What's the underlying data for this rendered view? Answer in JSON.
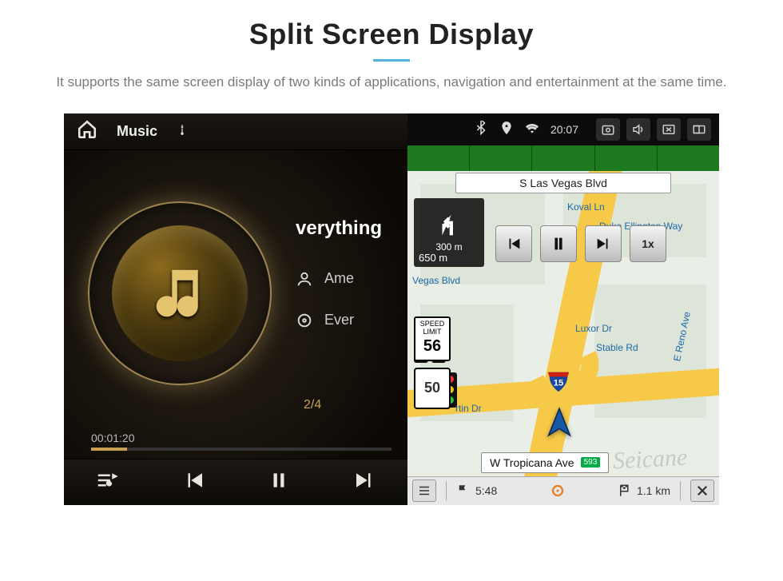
{
  "page": {
    "title": "Split Screen Display",
    "subtitle": "It supports the same screen display of two kinds of applications, navigation and entertainment at the same time."
  },
  "status_bar": {
    "time": "20:07",
    "icons": [
      "bluetooth",
      "location",
      "wifi"
    ]
  },
  "music": {
    "app_title": "Music",
    "now_playing_title": "verything",
    "artist": "Ame",
    "genre": "Ever",
    "track_position": "2/4",
    "elapsed": "00:01:20"
  },
  "nav": {
    "top_road": "S Las Vegas Blvd",
    "turn_distance_top": "300 m",
    "turn_distance_main": "650 m",
    "speed_limit_label": "SPEED LIMIT",
    "speed_limit_value": "56",
    "route_number": "50",
    "interstate": "15",
    "current_street": "W Tropicana Ave",
    "current_exit": "593",
    "overlay_speed": "1x",
    "eta": "5:48",
    "remaining_distance": "1.1 km",
    "street_labels": {
      "koval": "Koval Ln",
      "duke": "Duke Ellington Way",
      "vegas_blvd": "Vegas Blvd",
      "luxor": "Luxor Dr",
      "stable": "Stable Rd",
      "reno": "E Reno Ave",
      "martin": "rtin Dr"
    }
  },
  "watermark": "Seicane"
}
